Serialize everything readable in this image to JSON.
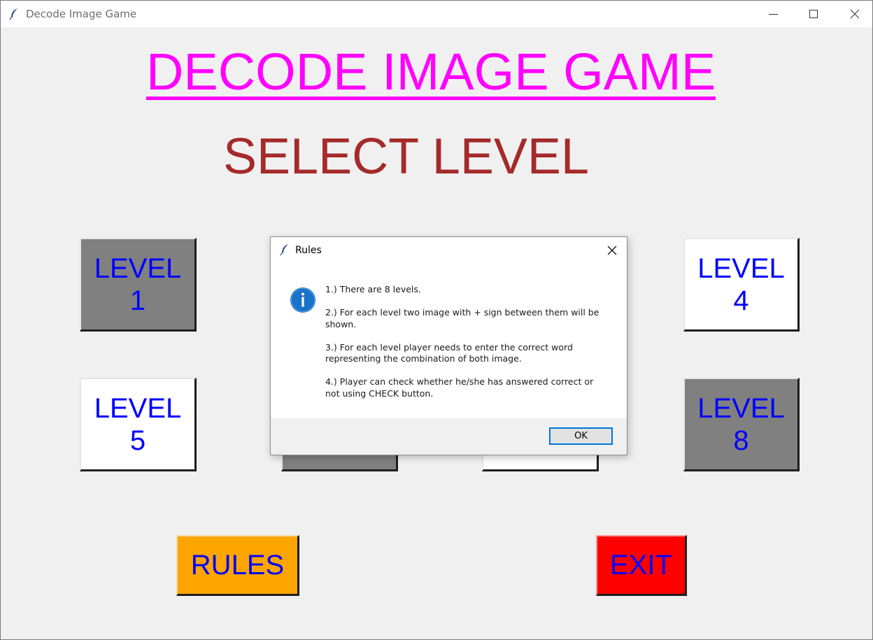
{
  "window": {
    "title": "Decode Image Game",
    "icons": [
      "feather-icon",
      "minimize-icon",
      "maximize-icon",
      "close-icon"
    ]
  },
  "main": {
    "heading": "DECODE IMAGE GAME",
    "subheading": "SELECT LEVEL",
    "levels": [
      {
        "line1": "LEVEL",
        "line2": "1"
      },
      {
        "line1": "LEVEL",
        "line2": "4"
      },
      {
        "line1": "LEVEL",
        "line2": "5"
      },
      {
        "line1": "LEVEL",
        "line2": "8"
      }
    ],
    "rules_label": "RULES",
    "exit_label": "EXIT"
  },
  "colors": {
    "heading": "#ff00ff",
    "subheading": "#a52a2a",
    "level_text": "#0000ff",
    "level_grey": "#808080",
    "level_white": "#ffffff",
    "rules_bg": "#ffa500",
    "exit_bg": "#ff0000"
  },
  "dialog": {
    "title": "Rules",
    "icon": "info-icon",
    "rules": [
      "1.)  There are 8 levels.",
      "2.)  For each level two image with + sign between them will be shown.",
      "3.)  For each level player needs to enter the correct word representing the combination of both image.",
      "4.)  Player can check whether he/she has answered correct or not using CHECK button."
    ],
    "ok_label": "OK"
  }
}
